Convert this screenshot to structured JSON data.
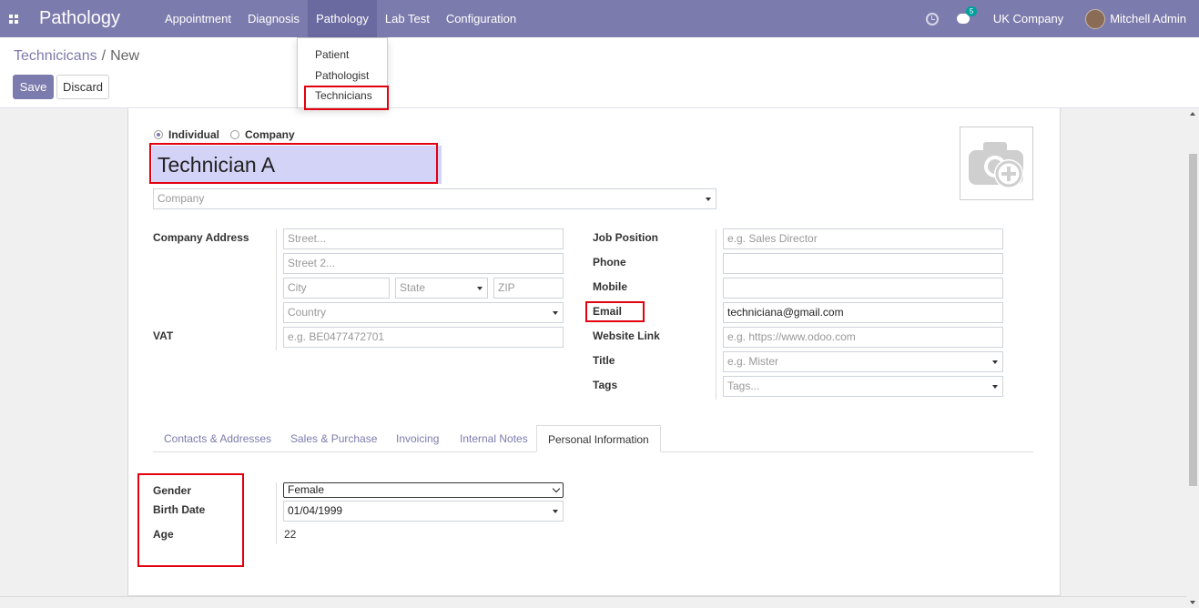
{
  "navbar": {
    "brand": "Pathology",
    "menu": [
      "Appointment",
      "Diagnosis",
      "Pathology",
      "Lab Test",
      "Configuration"
    ],
    "active_menu": "Pathology",
    "chat_count": "5",
    "company": "UK Company",
    "user": "Mitchell Admin"
  },
  "breadcrumb": {
    "parent": "Technicicans",
    "separator": "/",
    "current": "New"
  },
  "buttons": {
    "save": "Save",
    "discard": "Discard"
  },
  "pathology_menu": {
    "items": [
      "Patient",
      "Pathologist",
      "Technicians"
    ]
  },
  "form": {
    "type_individual": "Individual",
    "type_company": "Company",
    "selected_type": "Individual",
    "name": "Technician A",
    "company_placeholder": "Company",
    "left": {
      "company_address_label": "Company Address",
      "street_placeholder": "Street...",
      "street2_placeholder": "Street 2...",
      "city_placeholder": "City",
      "state_placeholder": "State",
      "zip_placeholder": "ZIP",
      "country_placeholder": "Country",
      "vat_label": "VAT",
      "vat_placeholder": "e.g. BE0477472701"
    },
    "right": {
      "job_position_label": "Job Position",
      "job_position_placeholder": "e.g. Sales Director",
      "phone_label": "Phone",
      "mobile_label": "Mobile",
      "email_label": "Email",
      "email_value": "techniciana@gmail.com",
      "website_label": "Website Link",
      "website_placeholder": "e.g. https://www.odoo.com",
      "title_label": "Title",
      "title_placeholder": "e.g. Mister",
      "tags_label": "Tags",
      "tags_placeholder": "Tags..."
    },
    "tabs": [
      "Contacts & Addresses",
      "Sales & Purchase",
      "Invoicing",
      "Internal Notes",
      "Personal Information"
    ],
    "active_tab": "Personal Information",
    "personal": {
      "gender_label": "Gender",
      "gender_value": "Female",
      "birth_date_label": "Birth Date",
      "birth_date_value": "01/04/1999",
      "age_label": "Age",
      "age_value": "22"
    }
  },
  "colors": {
    "navbar": "#7c7bad",
    "highlight": "#e3000f",
    "name_field_bg": "#d3d3f7"
  }
}
